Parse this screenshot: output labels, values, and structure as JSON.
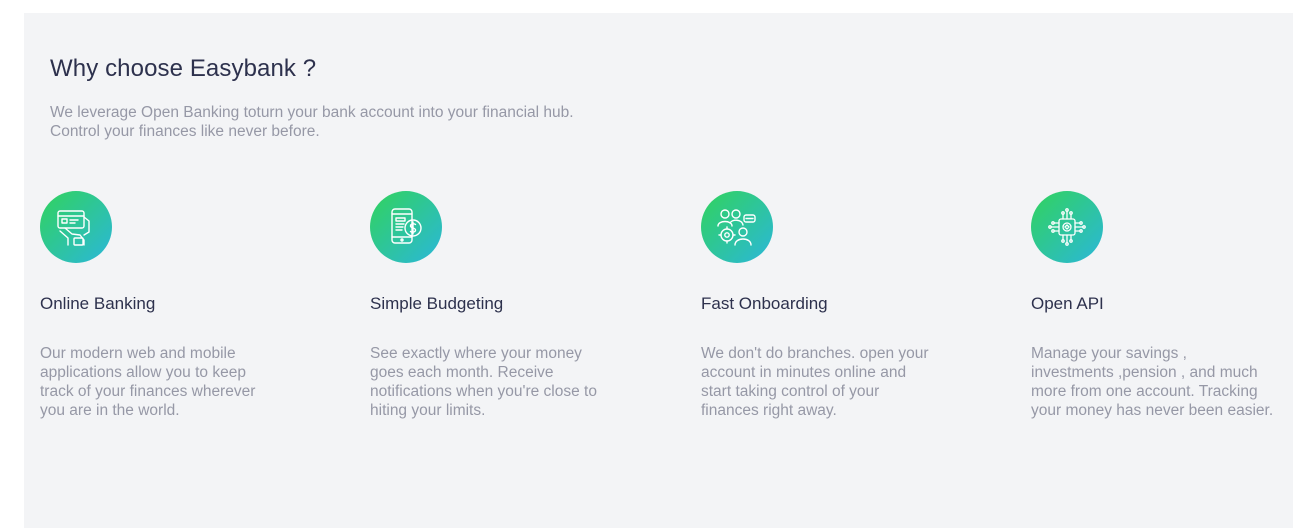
{
  "section": {
    "title": "Why choose Easybank ?",
    "intro_line1": "We leverage Open Banking toturn your bank account into your financial hub.",
    "intro_line2": "Control your finances like never before."
  },
  "features": [
    {
      "title": "Online Banking",
      "icon": "online-banking-icon",
      "lines": [
        "Our modern web and mobile",
        "applications allow you to keep",
        "track of your finances wherever",
        "you are in the world."
      ]
    },
    {
      "title": "Simple Budgeting",
      "icon": "budgeting-icon",
      "lines": [
        "See exactly where your money",
        "goes each month. Receive",
        "notifications when you're close to",
        "hiting your limits."
      ]
    },
    {
      "title": "Fast Onboarding",
      "icon": "onboarding-icon",
      "lines": [
        "We don't do branches. open your",
        "account in minutes online and",
        "start taking control of your",
        "finances right away."
      ]
    },
    {
      "title": "Open API",
      "icon": "api-icon",
      "lines": [
        "Manage your savings ,",
        "investments ,pension , and much",
        "more from one account. Tracking",
        "your money has never been easier."
      ]
    }
  ],
  "colors": {
    "background": "#f3f4f6",
    "heading": "#2d314d",
    "body_text": "#9698a6",
    "gradient_start": "#31d35c",
    "gradient_end": "#2bb7da"
  }
}
